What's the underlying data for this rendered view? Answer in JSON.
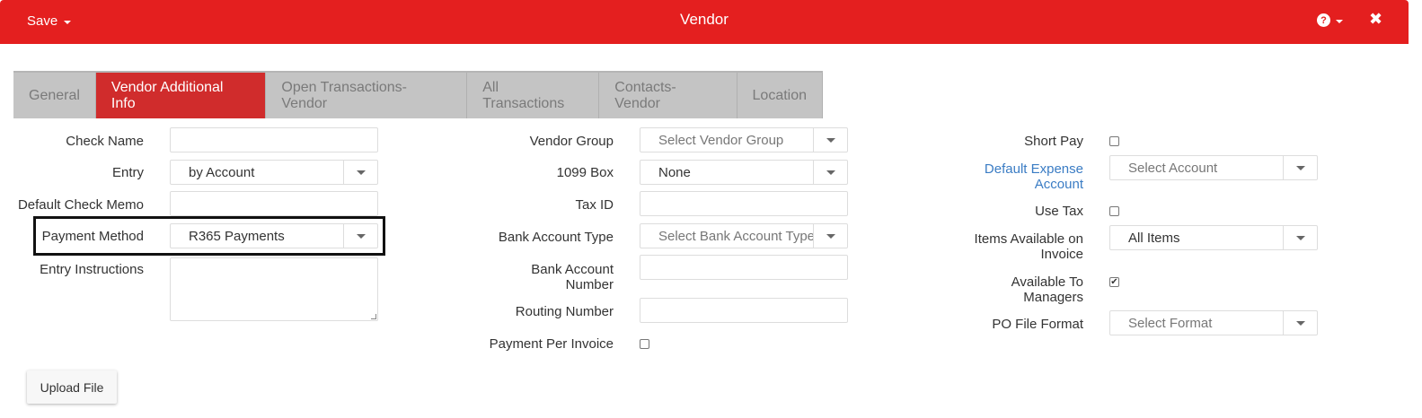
{
  "header": {
    "save_label": "Save",
    "title": "Vendor",
    "help_symbol": "?",
    "close_symbol": "✖",
    "accent_color": "#e41f1f"
  },
  "tabs": [
    {
      "label": "General",
      "active": false
    },
    {
      "label": "Vendor Additional Info",
      "active": true
    },
    {
      "label": "Open Transactions-Vendor",
      "active": false
    },
    {
      "label": "All Transactions",
      "active": false
    },
    {
      "label": "Contacts-Vendor",
      "active": false
    },
    {
      "label": "Location",
      "active": false
    }
  ],
  "col1": {
    "check_name": {
      "label": "Check Name",
      "value": ""
    },
    "entry": {
      "label": "Entry",
      "value": "by Account"
    },
    "default_check_memo": {
      "label": "Default Check Memo",
      "value": ""
    },
    "payment_method": {
      "label": "Payment Method",
      "value": "R365 Payments"
    },
    "entry_instructions": {
      "label": "Entry Instructions",
      "value": ""
    }
  },
  "col2": {
    "vendor_group": {
      "label": "Vendor Group",
      "placeholder": "Select Vendor Group"
    },
    "box_1099": {
      "label": "1099 Box",
      "value": "None"
    },
    "tax_id": {
      "label": "Tax ID",
      "value": ""
    },
    "bank_account_type": {
      "label": "Bank Account Type",
      "placeholder": "Select Bank Account Type"
    },
    "bank_account_number": {
      "label_line1": "Bank Account",
      "label_line2": "Number",
      "value": ""
    },
    "routing_number": {
      "label": "Routing Number",
      "value": ""
    },
    "payment_per_invoice": {
      "label": "Payment Per Invoice",
      "checked": false
    }
  },
  "col3": {
    "short_pay": {
      "label": "Short Pay",
      "checked": false
    },
    "default_expense_account": {
      "label_line1": "Default Expense",
      "label_line2": "Account",
      "placeholder": "Select Account"
    },
    "use_tax": {
      "label": "Use Tax",
      "checked": false
    },
    "items_available": {
      "label_line1": "Items Available on",
      "label_line2": "Invoice",
      "value": "All Items"
    },
    "available_to_managers": {
      "label_line1": "Available To",
      "label_line2": "Managers",
      "checked": true,
      "check_mark": "✔"
    },
    "po_file_format": {
      "label": "PO File Format",
      "placeholder": "Select Format"
    }
  },
  "upload_label": "Upload File"
}
